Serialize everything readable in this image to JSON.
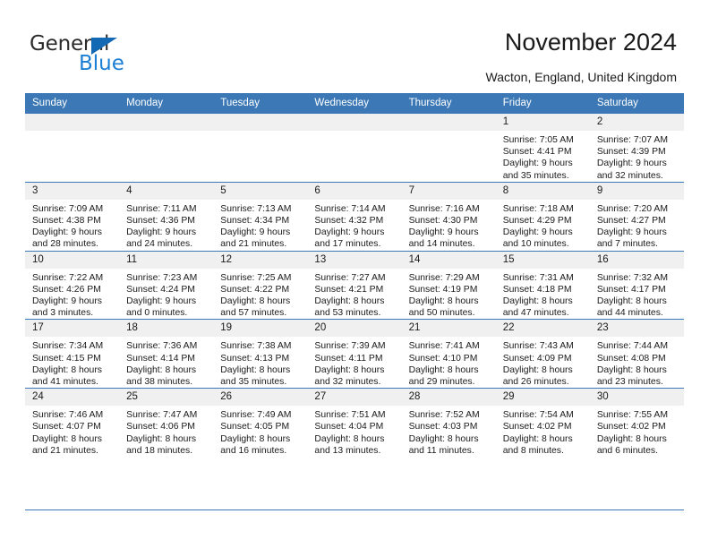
{
  "brand": {
    "name_top": "General",
    "name_bottom": "Blue",
    "triangle_color": "#1469b4",
    "blue_text_color": "#1b7fd4"
  },
  "header": {
    "title": "November 2024",
    "subtitle": "Wacton, England, United Kingdom"
  },
  "theme": {
    "header_bar_color": "#3b78b5",
    "daynum_band_color": "#f0f0f0",
    "row_rule_color": "#3b78b5"
  },
  "weekdays": [
    "Sunday",
    "Monday",
    "Tuesday",
    "Wednesday",
    "Thursday",
    "Friday",
    "Saturday"
  ],
  "labels": {
    "sunrise_prefix": "Sunrise:",
    "sunset_prefix": "Sunset:",
    "daylight_prefix": "Daylight:"
  },
  "weeks": [
    [
      {
        "day": "",
        "empty": true
      },
      {
        "day": "",
        "empty": true
      },
      {
        "day": "",
        "empty": true
      },
      {
        "day": "",
        "empty": true
      },
      {
        "day": "",
        "empty": true
      },
      {
        "day": "1",
        "sunrise": "Sunrise: 7:05 AM",
        "sunset": "Sunset: 4:41 PM",
        "daylight_line1": "Daylight: 9 hours",
        "daylight_line2": "and 35 minutes."
      },
      {
        "day": "2",
        "sunrise": "Sunrise: 7:07 AM",
        "sunset": "Sunset: 4:39 PM",
        "daylight_line1": "Daylight: 9 hours",
        "daylight_line2": "and 32 minutes."
      }
    ],
    [
      {
        "day": "3",
        "sunrise": "Sunrise: 7:09 AM",
        "sunset": "Sunset: 4:38 PM",
        "daylight_line1": "Daylight: 9 hours",
        "daylight_line2": "and 28 minutes."
      },
      {
        "day": "4",
        "sunrise": "Sunrise: 7:11 AM",
        "sunset": "Sunset: 4:36 PM",
        "daylight_line1": "Daylight: 9 hours",
        "daylight_line2": "and 24 minutes."
      },
      {
        "day": "5",
        "sunrise": "Sunrise: 7:13 AM",
        "sunset": "Sunset: 4:34 PM",
        "daylight_line1": "Daylight: 9 hours",
        "daylight_line2": "and 21 minutes."
      },
      {
        "day": "6",
        "sunrise": "Sunrise: 7:14 AM",
        "sunset": "Sunset: 4:32 PM",
        "daylight_line1": "Daylight: 9 hours",
        "daylight_line2": "and 17 minutes."
      },
      {
        "day": "7",
        "sunrise": "Sunrise: 7:16 AM",
        "sunset": "Sunset: 4:30 PM",
        "daylight_line1": "Daylight: 9 hours",
        "daylight_line2": "and 14 minutes."
      },
      {
        "day": "8",
        "sunrise": "Sunrise: 7:18 AM",
        "sunset": "Sunset: 4:29 PM",
        "daylight_line1": "Daylight: 9 hours",
        "daylight_line2": "and 10 minutes."
      },
      {
        "day": "9",
        "sunrise": "Sunrise: 7:20 AM",
        "sunset": "Sunset: 4:27 PM",
        "daylight_line1": "Daylight: 9 hours",
        "daylight_line2": "and 7 minutes."
      }
    ],
    [
      {
        "day": "10",
        "sunrise": "Sunrise: 7:22 AM",
        "sunset": "Sunset: 4:26 PM",
        "daylight_line1": "Daylight: 9 hours",
        "daylight_line2": "and 3 minutes."
      },
      {
        "day": "11",
        "sunrise": "Sunrise: 7:23 AM",
        "sunset": "Sunset: 4:24 PM",
        "daylight_line1": "Daylight: 9 hours",
        "daylight_line2": "and 0 minutes."
      },
      {
        "day": "12",
        "sunrise": "Sunrise: 7:25 AM",
        "sunset": "Sunset: 4:22 PM",
        "daylight_line1": "Daylight: 8 hours",
        "daylight_line2": "and 57 minutes."
      },
      {
        "day": "13",
        "sunrise": "Sunrise: 7:27 AM",
        "sunset": "Sunset: 4:21 PM",
        "daylight_line1": "Daylight: 8 hours",
        "daylight_line2": "and 53 minutes."
      },
      {
        "day": "14",
        "sunrise": "Sunrise: 7:29 AM",
        "sunset": "Sunset: 4:19 PM",
        "daylight_line1": "Daylight: 8 hours",
        "daylight_line2": "and 50 minutes."
      },
      {
        "day": "15",
        "sunrise": "Sunrise: 7:31 AM",
        "sunset": "Sunset: 4:18 PM",
        "daylight_line1": "Daylight: 8 hours",
        "daylight_line2": "and 47 minutes."
      },
      {
        "day": "16",
        "sunrise": "Sunrise: 7:32 AM",
        "sunset": "Sunset: 4:17 PM",
        "daylight_line1": "Daylight: 8 hours",
        "daylight_line2": "and 44 minutes."
      }
    ],
    [
      {
        "day": "17",
        "sunrise": "Sunrise: 7:34 AM",
        "sunset": "Sunset: 4:15 PM",
        "daylight_line1": "Daylight: 8 hours",
        "daylight_line2": "and 41 minutes."
      },
      {
        "day": "18",
        "sunrise": "Sunrise: 7:36 AM",
        "sunset": "Sunset: 4:14 PM",
        "daylight_line1": "Daylight: 8 hours",
        "daylight_line2": "and 38 minutes."
      },
      {
        "day": "19",
        "sunrise": "Sunrise: 7:38 AM",
        "sunset": "Sunset: 4:13 PM",
        "daylight_line1": "Daylight: 8 hours",
        "daylight_line2": "and 35 minutes."
      },
      {
        "day": "20",
        "sunrise": "Sunrise: 7:39 AM",
        "sunset": "Sunset: 4:11 PM",
        "daylight_line1": "Daylight: 8 hours",
        "daylight_line2": "and 32 minutes."
      },
      {
        "day": "21",
        "sunrise": "Sunrise: 7:41 AM",
        "sunset": "Sunset: 4:10 PM",
        "daylight_line1": "Daylight: 8 hours",
        "daylight_line2": "and 29 minutes."
      },
      {
        "day": "22",
        "sunrise": "Sunrise: 7:43 AM",
        "sunset": "Sunset: 4:09 PM",
        "daylight_line1": "Daylight: 8 hours",
        "daylight_line2": "and 26 minutes."
      },
      {
        "day": "23",
        "sunrise": "Sunrise: 7:44 AM",
        "sunset": "Sunset: 4:08 PM",
        "daylight_line1": "Daylight: 8 hours",
        "daylight_line2": "and 23 minutes."
      }
    ],
    [
      {
        "day": "24",
        "sunrise": "Sunrise: 7:46 AM",
        "sunset": "Sunset: 4:07 PM",
        "daylight_line1": "Daylight: 8 hours",
        "daylight_line2": "and 21 minutes."
      },
      {
        "day": "25",
        "sunrise": "Sunrise: 7:47 AM",
        "sunset": "Sunset: 4:06 PM",
        "daylight_line1": "Daylight: 8 hours",
        "daylight_line2": "and 18 minutes."
      },
      {
        "day": "26",
        "sunrise": "Sunrise: 7:49 AM",
        "sunset": "Sunset: 4:05 PM",
        "daylight_line1": "Daylight: 8 hours",
        "daylight_line2": "and 16 minutes."
      },
      {
        "day": "27",
        "sunrise": "Sunrise: 7:51 AM",
        "sunset": "Sunset: 4:04 PM",
        "daylight_line1": "Daylight: 8 hours",
        "daylight_line2": "and 13 minutes."
      },
      {
        "day": "28",
        "sunrise": "Sunrise: 7:52 AM",
        "sunset": "Sunset: 4:03 PM",
        "daylight_line1": "Daylight: 8 hours",
        "daylight_line2": "and 11 minutes."
      },
      {
        "day": "29",
        "sunrise": "Sunrise: 7:54 AM",
        "sunset": "Sunset: 4:02 PM",
        "daylight_line1": "Daylight: 8 hours",
        "daylight_line2": "and 8 minutes."
      },
      {
        "day": "30",
        "sunrise": "Sunrise: 7:55 AM",
        "sunset": "Sunset: 4:02 PM",
        "daylight_line1": "Daylight: 8 hours",
        "daylight_line2": "and 6 minutes."
      }
    ]
  ]
}
